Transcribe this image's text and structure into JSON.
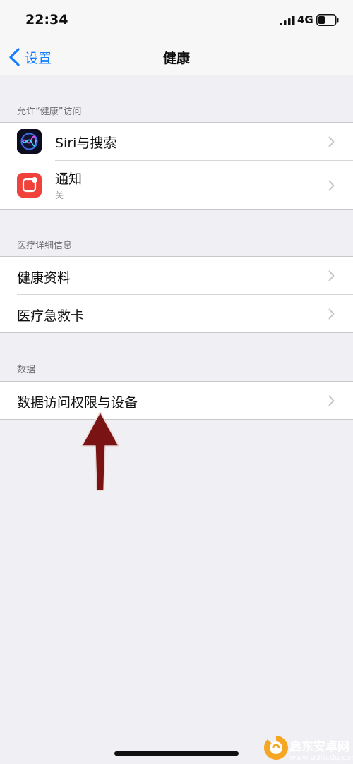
{
  "status_bar": {
    "time": "22:34",
    "network": "4G"
  },
  "nav": {
    "back_label": "设置",
    "title": "健康"
  },
  "sections": [
    {
      "header": "允许“健康”访问",
      "items": [
        {
          "label": "Siri与搜索",
          "icon": "siri-icon"
        },
        {
          "label": "通知",
          "sub": "关",
          "icon": "notification-icon"
        }
      ]
    },
    {
      "header": "医疗详细信息",
      "items": [
        {
          "label": "健康资料"
        },
        {
          "label": "医疗急救卡"
        }
      ]
    },
    {
      "header": "数据",
      "items": [
        {
          "label": "数据访问权限与设备"
        }
      ]
    }
  ],
  "watermark": {
    "title": "启东安卓网",
    "url": "www.qdltcdq.com"
  },
  "colors": {
    "accent": "#147efb",
    "background": "#efeff4",
    "arrow": "#7a1414"
  }
}
